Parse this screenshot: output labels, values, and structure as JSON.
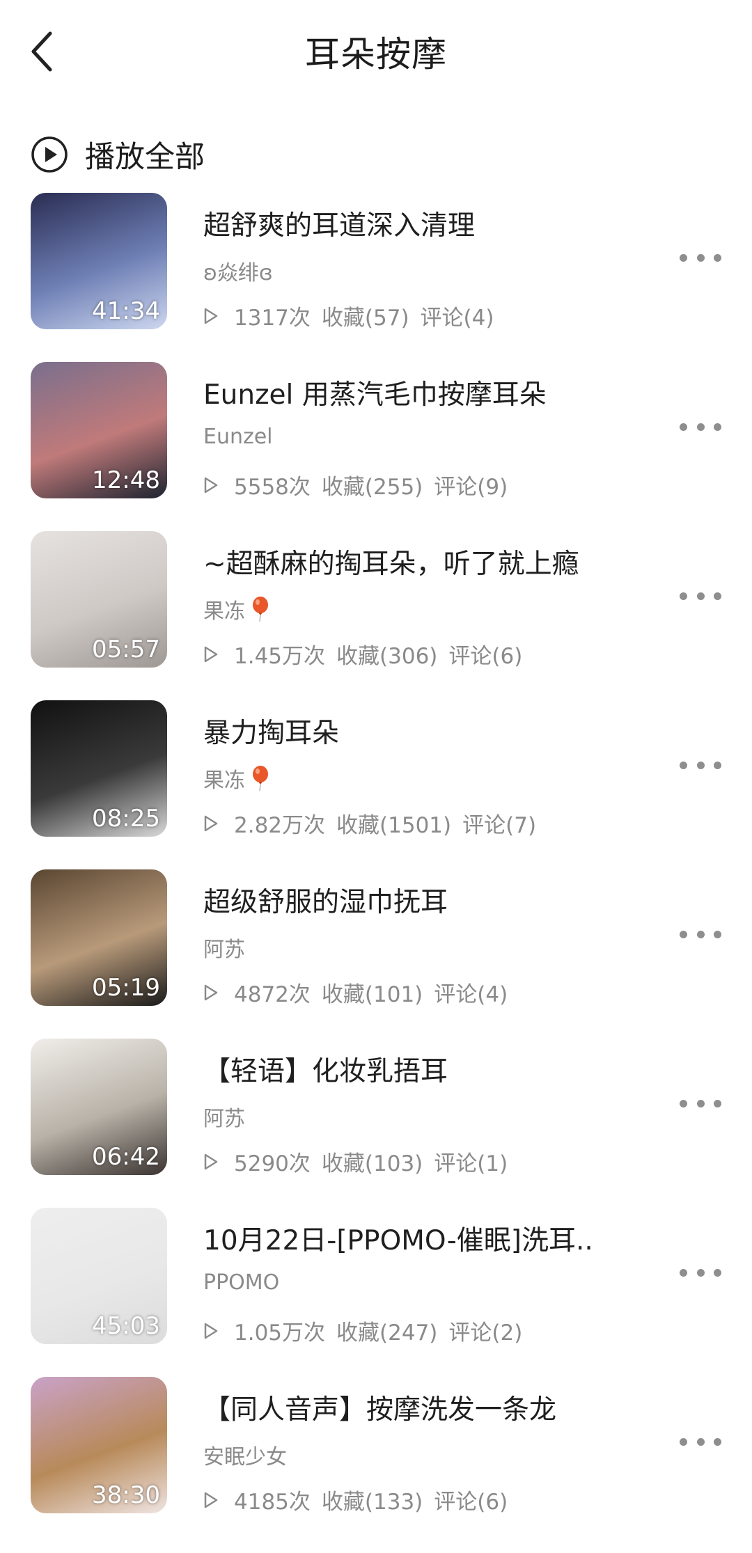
{
  "header": {
    "title": "耳朵按摩",
    "back_icon": "chevron-left-icon"
  },
  "play_all": {
    "label": "播放全部",
    "icon": "play-circle-icon"
  },
  "items": [
    {
      "title": "超舒爽的耳道深入清理",
      "author": "ʚ焱绯ɞ",
      "balloon": false,
      "duration": "41:34",
      "plays": "1317次",
      "favorites": "收藏(57)",
      "comments": "评论(4)",
      "colors": [
        "#2a2d52",
        "#6e7fb5",
        "#cdd7ef"
      ]
    },
    {
      "title": "Eunzel 用蒸汽毛巾按摩耳朵",
      "author": "Eunzel",
      "balloon": false,
      "duration": "12:48",
      "plays": "5558次",
      "favorites": "收藏(255)",
      "comments": "评论(9)",
      "colors": [
        "#7a6f8d",
        "#c07a7a",
        "#1d2430"
      ]
    },
    {
      "title": "~超酥麻的掏耳朵，听了就上瘾",
      "author": "果冻",
      "balloon": true,
      "duration": "05:57",
      "plays": "1.45万次",
      "favorites": "收藏(306)",
      "comments": "评论(6)",
      "colors": [
        "#e6e2df",
        "#cfc9c6",
        "#9d9894"
      ]
    },
    {
      "title": "暴力掏耳朵",
      "author": "果冻",
      "balloon": true,
      "duration": "08:25",
      "plays": "2.82万次",
      "favorites": "收藏(1501)",
      "comments": "评论(7)",
      "colors": [
        "#111111",
        "#3a3a3a",
        "#d8d8d8"
      ]
    },
    {
      "title": "超级舒服的湿巾抚耳",
      "author": "阿苏",
      "balloon": false,
      "duration": "05:19",
      "plays": "4872次",
      "favorites": "收藏(101)",
      "comments": "评论(4)",
      "colors": [
        "#5a4632",
        "#b89a7a",
        "#1a1a1a"
      ]
    },
    {
      "title": "【轻语】化妆乳捂耳",
      "author": "阿苏",
      "balloon": false,
      "duration": "06:42",
      "plays": "5290次",
      "favorites": "收藏(103)",
      "comments": "评论(1)",
      "colors": [
        "#f0eeea",
        "#b9b2a8",
        "#3a3330"
      ]
    },
    {
      "title": "10月22日-[PPOMO-催眠]洗耳..",
      "author": "PPOMO",
      "balloon": false,
      "duration": "45:03",
      "plays": "1.05万次",
      "favorites": "收藏(247)",
      "comments": "评论(2)",
      "colors": [
        "#eeeeee",
        "#e8e8e8",
        "#dcdcdc"
      ]
    },
    {
      "title": "【同人音声】按摩洗发一条龙",
      "author": "安眠少女",
      "balloon": false,
      "duration": "38:30",
      "plays": "4185次",
      "favorites": "收藏(133)",
      "comments": "评论(6)",
      "colors": [
        "#c9a2c8",
        "#b88a5a",
        "#efe4e2"
      ]
    }
  ]
}
